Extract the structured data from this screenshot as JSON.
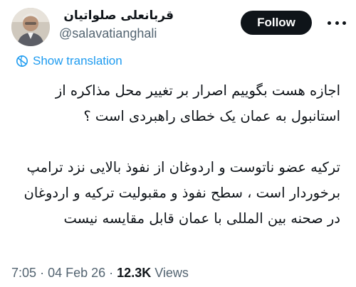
{
  "author": {
    "display_name": "قربانعلی صلواتیان",
    "handle": "@salavatianghali"
  },
  "actions": {
    "follow_label": "Follow"
  },
  "translate": {
    "label": "Show translation"
  },
  "tweet": {
    "lines": [
      "اجازه هست بگوییم اصرار بر تغییر محل مذاکره از",
      "استانبول به عمان یک خطای راهبردی  است ؟",
      "",
      "ترکیه عضو ناتوست و اردوغان از نفوذ بالایی نزد ترامپ",
      "برخوردار است ، سطح نفوذ و مقبولیت ترکیه و اردوغان",
      "در صحنه بین المللی با عمان قابل مقایسه نیست"
    ]
  },
  "meta": {
    "time": "7:05",
    "separator": "·",
    "date": "04 Feb 26",
    "views_count": "12.3K",
    "views_label": "Views"
  },
  "icons": {
    "translate": "globe-icon",
    "more": "more-options-icon"
  },
  "colors": {
    "text": "#0f1419",
    "secondary": "#536471",
    "link": "#1d9bf0",
    "button_bg": "#0f1419"
  }
}
